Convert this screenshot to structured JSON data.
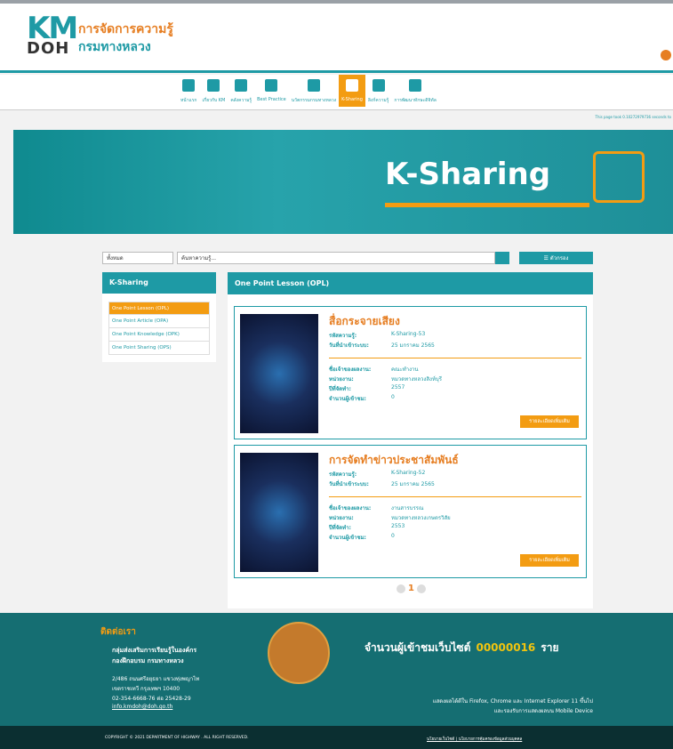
{
  "header": {
    "logo_km": "KM",
    "logo_doh": "DOH",
    "logo_title1": "การจัดการความรู้",
    "logo_title2": "กรมทางหลวง"
  },
  "nav": [
    {
      "label": "หน้าแรก",
      "icon": "home-icon"
    },
    {
      "label": "เกี่ยวกับ KM",
      "icon": "info-icon"
    },
    {
      "label": "คลังความรู้",
      "icon": "book-icon"
    },
    {
      "label": "Best Practice",
      "icon": "thumbs-up-icon"
    },
    {
      "label": "นวัตกรรมกรมทางหลวง",
      "icon": "lightbulb-icon"
    },
    {
      "label": "K-Sharing",
      "icon": "share-icon",
      "active": true
    },
    {
      "label": "ลิงก์ความรู้",
      "icon": "link-icon"
    },
    {
      "label": "การพัฒนาทักษะดิจิทัล",
      "icon": "laptop-icon"
    }
  ],
  "page_time": "This page took 0.10272979736 seconds to",
  "banner": {
    "title": "K-Sharing"
  },
  "search": {
    "scope": "ทั้งหมด",
    "placeholder": "ค้นหาความรู้...",
    "filter_label": "☰ ตัวกรอง"
  },
  "sidebar": {
    "title": "K-Sharing",
    "items": [
      "One Point Lesson (OPL)",
      "One Point Article (OPA)",
      "One Point Knowledge (OPK)",
      "One Point Sharing (OPS)"
    ]
  },
  "main": {
    "title": "One Point Lesson (OPL)",
    "labels": {
      "code": "รหัสความรู้:",
      "date": "วันที่นำเข้าระบบ:",
      "owner": "ชื่อเจ้าของผลงาน:",
      "unit": "หน่วยงาน:",
      "year": "ปีที่จัดทำ:",
      "viewers": "จำนวนผู้เข้าชม:"
    },
    "more": "รายละเอียดเพิ่มเติม",
    "cards": [
      {
        "title": "สื่อกระจายเสียง",
        "code": "K-Sharing-53",
        "date": "25 มกราคม 2565",
        "owner": "คณะทำงาน",
        "unit": "หมวดทางหลวงสิงห์บุรี",
        "year": "2557",
        "viewers": "0"
      },
      {
        "title": "การจัดทำข่าวประชาสัมพันธ์",
        "code": "K-Sharing-52",
        "date": "25 มกราคม 2565",
        "owner": "งานสารบรรณ",
        "unit": "หมวดทางหลวงเกษตรวิสัย",
        "year": "2553",
        "viewers": "0"
      }
    ]
  },
  "pagination": {
    "current": "1"
  },
  "footer": {
    "contact_title": "ติดต่อเรา",
    "org_line1": "กลุ่มส่งเสริมการเรียนรู้ในองค์กร",
    "org_line2": "กองฝึกอบรม กรมทางหลวง",
    "address1": "2/486 ถนนศรีอยุธยา แขวงทุ่งพญาไท",
    "address2": "เขตราชเทวี กรุงเทพฯ 10400",
    "phone": "02-354-6668-76 ต่อ 25428-29",
    "email": "info.kmdoh@doh.go.th",
    "visitor_label": "จำนวนผู้เข้าชมเว็บไซต์",
    "visitor_count": "00000016",
    "visitor_unit": "ราย",
    "browser1": "แสดงผลได้ดีใน Firefox, Chrome และ Internet Explorer 11 ขึ้นไป",
    "browser2": "และรองรับการแสดงผลบน Mobile Device"
  },
  "bottom": {
    "copyright": "COPYRIGHT © 2021 DEPARTMENT OF HIGHWAY . ALL RIGHT RESERVED.",
    "links": "นโยบายเว็บไซต์ | นโยบายการคุ้มครองข้อมูลส่วนบุคคล"
  }
}
